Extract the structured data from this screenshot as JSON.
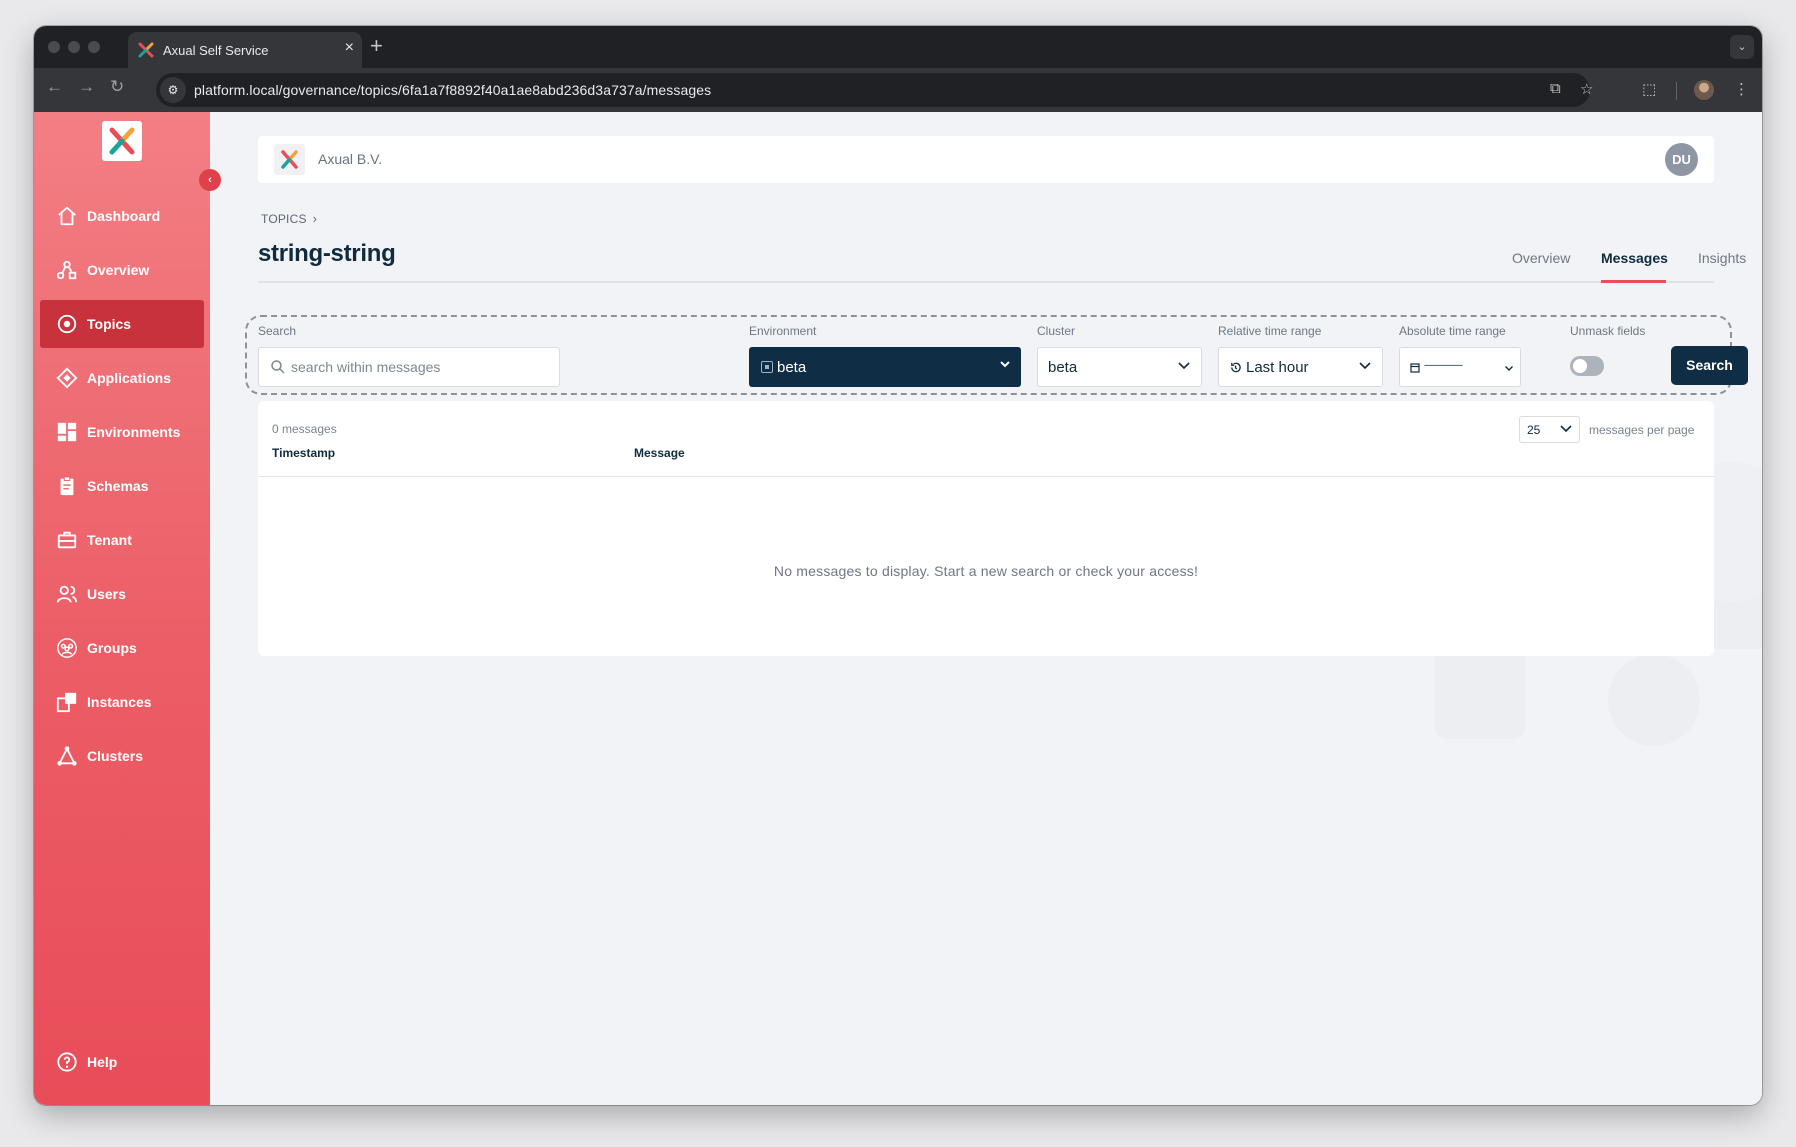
{
  "browser": {
    "tab_title": "Axual Self Service",
    "url": "platform.local/governance/topics/6fa1a7f8892f40a1ae8abd236d3a737a/messages"
  },
  "sidebar": {
    "items": [
      {
        "label": "Dashboard",
        "icon": "home-icon"
      },
      {
        "label": "Overview",
        "icon": "overview-nodes-icon"
      },
      {
        "label": "Topics",
        "icon": "target-circle-icon",
        "active": true
      },
      {
        "label": "Applications",
        "icon": "diamond-icon"
      },
      {
        "label": "Environments",
        "icon": "grid-blocks-icon"
      },
      {
        "label": "Schemas",
        "icon": "clipboard-icon"
      },
      {
        "label": "Tenant",
        "icon": "briefcase-icon"
      },
      {
        "label": "Users",
        "icon": "users-icon"
      },
      {
        "label": "Groups",
        "icon": "groups-icon"
      },
      {
        "label": "Instances",
        "icon": "instances-icon"
      },
      {
        "label": "Clusters",
        "icon": "cluster-triangle-icon"
      }
    ],
    "help_label": "Help"
  },
  "header": {
    "org_name": "Axual B.V.",
    "avatar_initials": "DU"
  },
  "breadcrumb": {
    "root": "TOPICS",
    "separator": "›"
  },
  "page": {
    "title": "string-string",
    "tabs": [
      {
        "label": "Overview"
      },
      {
        "label": "Messages",
        "active": true
      },
      {
        "label": "Insights"
      }
    ]
  },
  "filters": {
    "search_label": "Search",
    "search_placeholder": "search within messages",
    "environment_label": "Environment",
    "environment_value": "beta",
    "cluster_label": "Cluster",
    "cluster_value": "beta",
    "relative_label": "Relative time range",
    "relative_value": "Last hour",
    "absolute_label": "Absolute time range",
    "absolute_value": "-------------------",
    "unmask_label": "Unmask fields",
    "unmask_on": false,
    "search_button": "Search"
  },
  "results": {
    "count_text": "0 messages",
    "columns": [
      "Timestamp",
      "Message"
    ],
    "per_page_value": "25",
    "per_page_label": "messages per page",
    "empty_text": "No messages to display. Start a new search or check your access!"
  },
  "colors": {
    "sidebar_top": "#f27f84",
    "sidebar_bottom": "#e84d58",
    "sidebar_active": "#c8323d",
    "navy": "#0f2d44",
    "accent": "#e84d58"
  }
}
